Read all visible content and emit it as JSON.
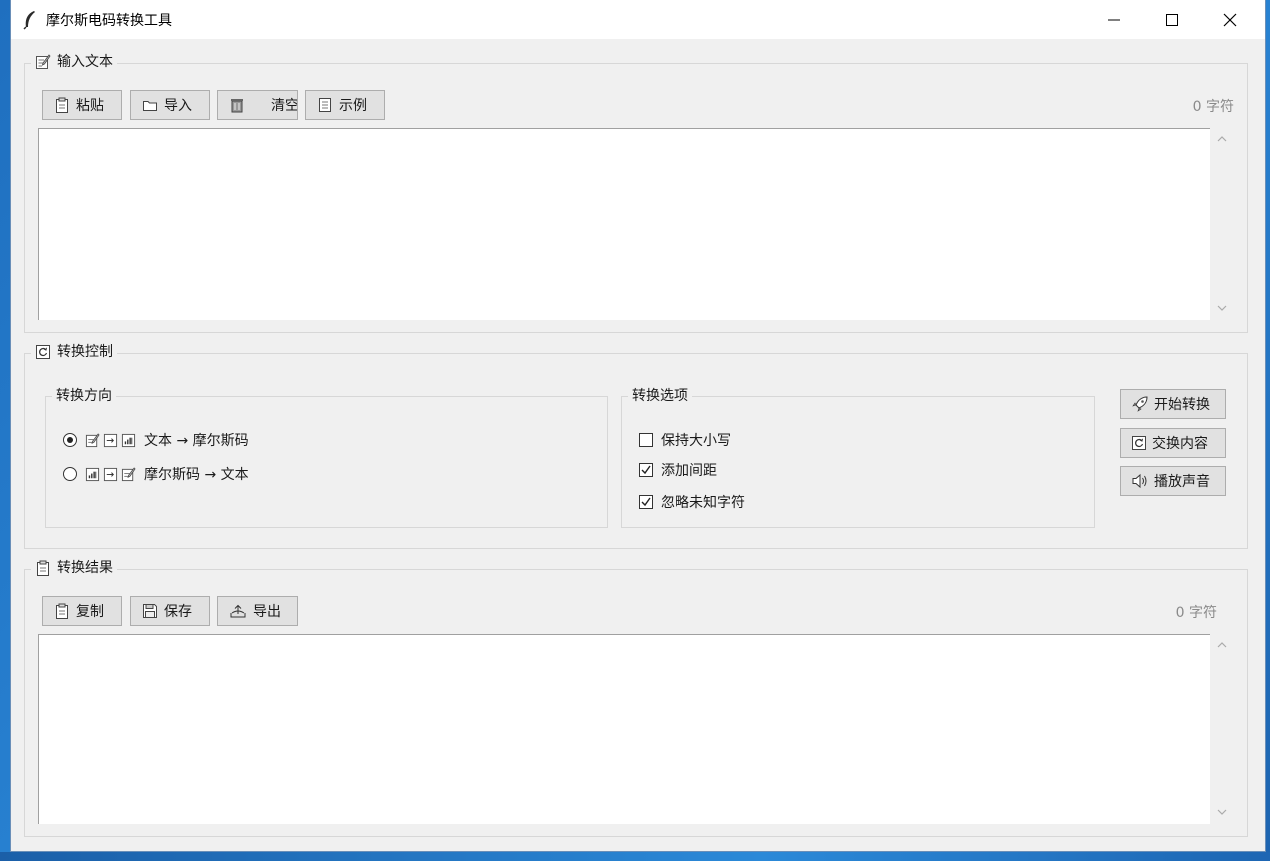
{
  "window": {
    "title": "摩尔斯电码转换工具"
  },
  "input": {
    "legend": "输入文本",
    "buttons": {
      "paste": "粘贴",
      "import": "导入",
      "clear": "清空",
      "example": "示例"
    },
    "count": "0 字符",
    "text": ""
  },
  "control": {
    "legend": "转换控制",
    "direction": {
      "legend": "转换方向",
      "option1": "文本 → 摩尔斯码",
      "option2": "摩尔斯码 → 文本",
      "selected": "option1"
    },
    "options": {
      "legend": "转换选项",
      "keep_case": "保持大小写",
      "add_spacing": "添加间距",
      "ignore_unknown": "忽略未知字符",
      "keep_case_checked": false,
      "add_spacing_checked": true,
      "ignore_unknown_checked": true
    },
    "actions": {
      "start": "开始转换",
      "swap": "交换内容",
      "play": "播放声音"
    }
  },
  "result": {
    "legend": "转换结果",
    "buttons": {
      "copy": "复制",
      "save": "保存",
      "export": "导出"
    },
    "count": "0 字符",
    "text": ""
  }
}
